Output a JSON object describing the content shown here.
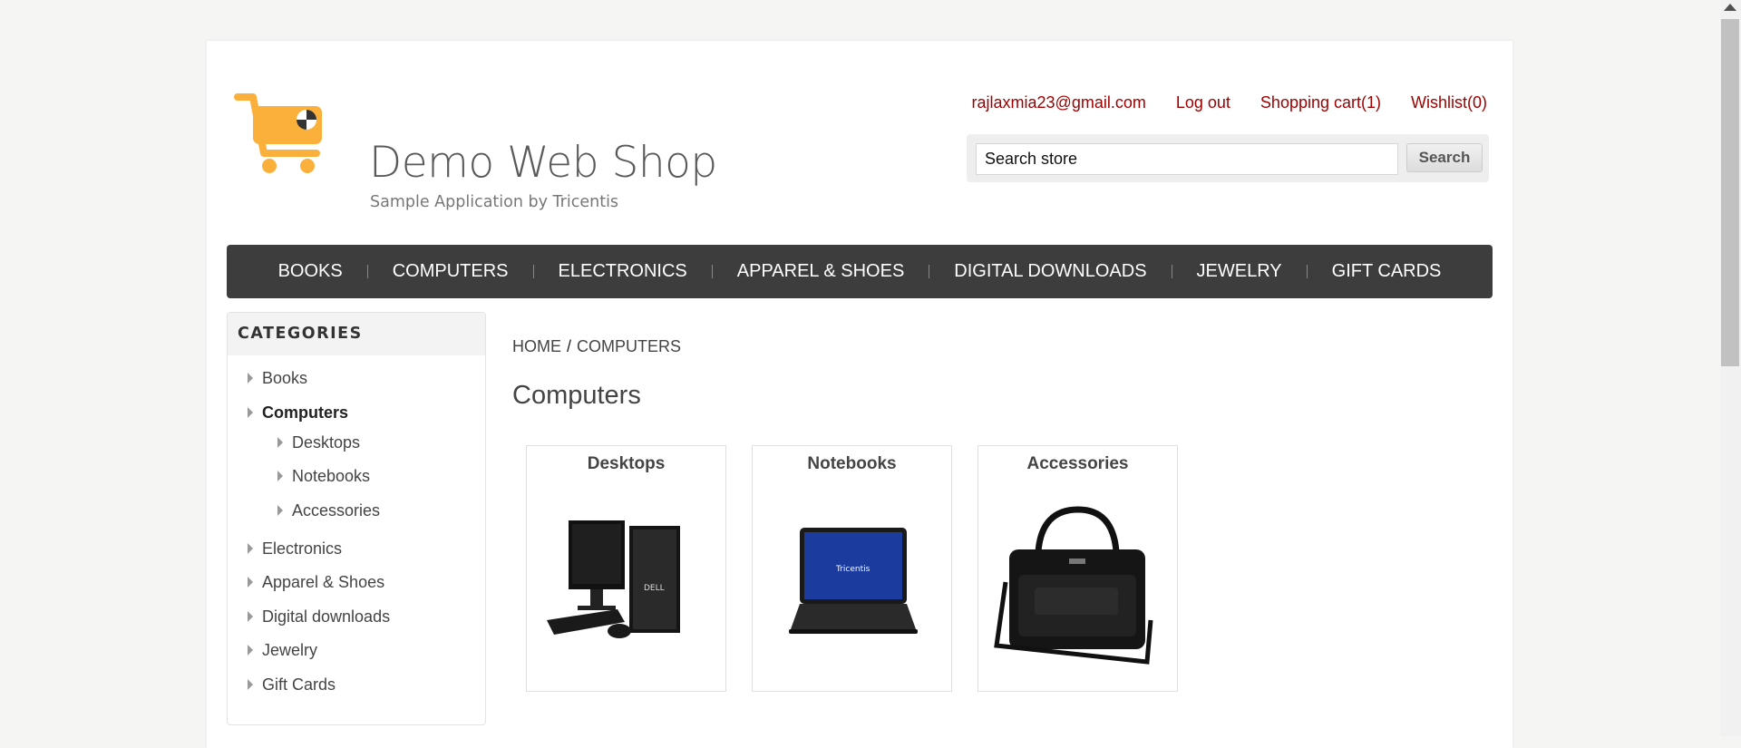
{
  "brand": {
    "title": "Demo Web Shop",
    "subtitle": "Sample Application by Tricentis",
    "logo_color": "#fbb03b"
  },
  "header": {
    "account_email": "rajlaxmia23@gmail.com",
    "logout": "Log out",
    "cart": "Shopping cart(1)",
    "wishlist": "Wishlist(0)",
    "link_color": "#a10000"
  },
  "search": {
    "placeholder": "Search store",
    "button": "Search"
  },
  "top_menu": [
    "BOOKS",
    "COMPUTERS",
    "ELECTRONICS",
    "APPAREL & SHOES",
    "DIGITAL DOWNLOADS",
    "JEWELRY",
    "GIFT CARDS"
  ],
  "sidebar": {
    "title": "CATEGORIES",
    "items": [
      {
        "label": "Books"
      },
      {
        "label": "Computers",
        "active": true
      },
      {
        "label": "Desktops"
      },
      {
        "label": "Notebooks"
      },
      {
        "label": "Accessories"
      },
      {
        "label": "Electronics"
      },
      {
        "label": "Apparel & Shoes"
      },
      {
        "label": "Digital downloads"
      },
      {
        "label": "Jewelry"
      },
      {
        "label": "Gift Cards"
      }
    ]
  },
  "breadcrumb": {
    "home": "HOME",
    "separator": "/",
    "current": "COMPUTERS"
  },
  "main": {
    "title": "Computers",
    "subcategories": [
      {
        "title": "Desktops",
        "icon": "desktop-computer-image"
      },
      {
        "title": "Notebooks",
        "icon": "laptop-image",
        "screen_text": "Tricentis"
      },
      {
        "title": "Accessories",
        "icon": "laptop-bag-image"
      }
    ]
  }
}
